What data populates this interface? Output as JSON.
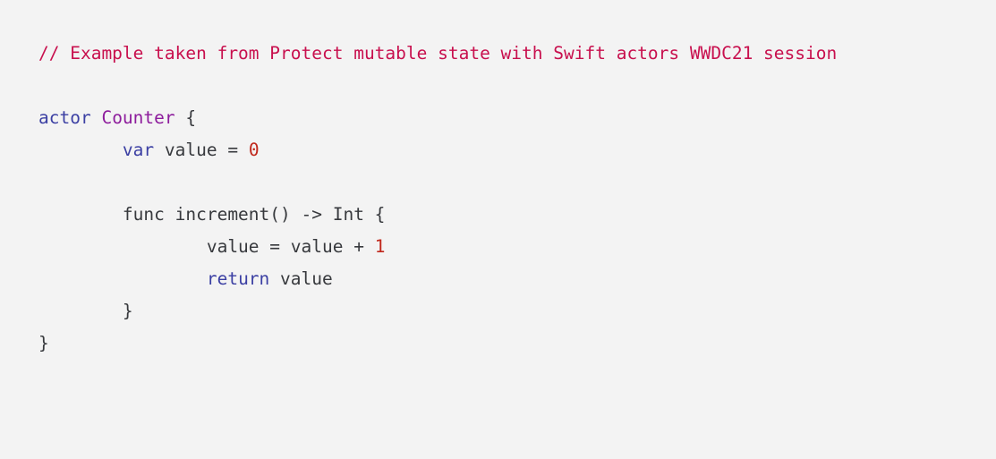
{
  "colors": {
    "background": "#f3f3f3",
    "comment": "#c8104e",
    "keyword": "#3b3fa3",
    "type": "#8d1c9c",
    "number": "#c0271b",
    "plain": "#37393d"
  },
  "code": {
    "lines": [
      [
        {
          "t": "comment",
          "v": "// Example taken from Protect mutable state with Swift actors WWDC21 session"
        }
      ],
      [],
      [
        {
          "t": "keyword",
          "v": "actor"
        },
        {
          "t": "plain",
          "v": " "
        },
        {
          "t": "type",
          "v": "Counter"
        },
        {
          "t": "plain",
          "v": " {"
        }
      ],
      [
        {
          "t": "plain",
          "v": "        "
        },
        {
          "t": "keyword",
          "v": "var"
        },
        {
          "t": "plain",
          "v": " value = "
        },
        {
          "t": "number",
          "v": "0"
        }
      ],
      [],
      [
        {
          "t": "plain",
          "v": "        func increment() -> Int {"
        }
      ],
      [
        {
          "t": "plain",
          "v": "                value = value + "
        },
        {
          "t": "number",
          "v": "1"
        }
      ],
      [
        {
          "t": "plain",
          "v": "                "
        },
        {
          "t": "keyword",
          "v": "return"
        },
        {
          "t": "plain",
          "v": " value"
        }
      ],
      [
        {
          "t": "plain",
          "v": "        }"
        }
      ],
      [
        {
          "t": "plain",
          "v": "}"
        }
      ]
    ]
  }
}
